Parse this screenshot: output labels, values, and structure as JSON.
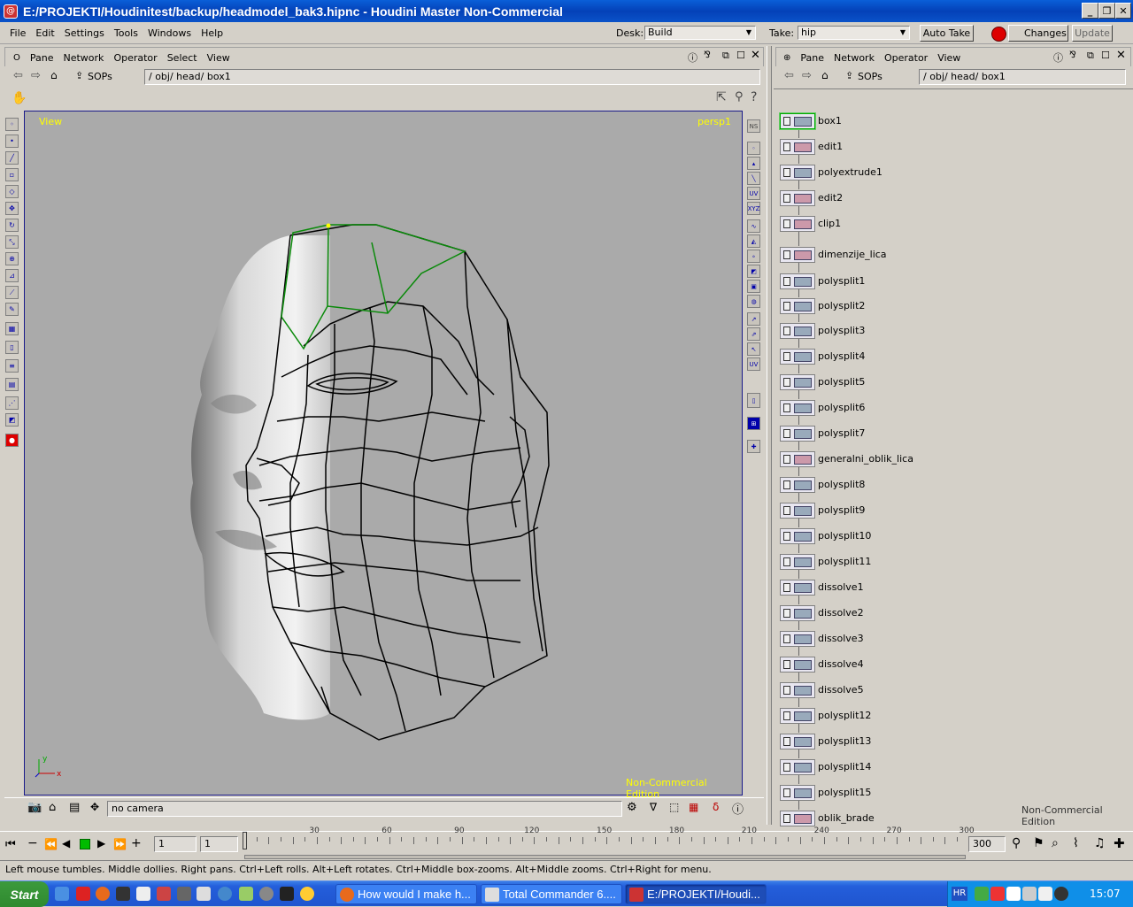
{
  "window": {
    "title": "E:/PROJEKTI/Houdinitest/backup/headmodel_bak3.hipnc - Houdini Master Non-Commercial"
  },
  "menu": [
    "File",
    "Edit",
    "Settings",
    "Tools",
    "Windows",
    "Help"
  ],
  "desk": {
    "label": "Desk:",
    "value": "Build"
  },
  "take": {
    "label": "Take:",
    "value": "hip"
  },
  "buttons": {
    "auto_take": "Auto Take",
    "changes": "Changes",
    "update": "Update"
  },
  "left_pane": {
    "menu": [
      "Pane",
      "Network",
      "Operator",
      "Select",
      "View"
    ],
    "context": "SOPs",
    "path": "/ obj/ head/ box1"
  },
  "right_pane": {
    "menu": [
      "Pane",
      "Network",
      "Operator",
      "View"
    ],
    "context": "SOPs",
    "path": "/ obj/ head/ box1"
  },
  "viewport": {
    "label_left": "View",
    "label_right": "persp1",
    "watermark": "Non-Commercial Edition",
    "camera": "no camera",
    "axis_x": "x",
    "axis_y": "y",
    "accent": "#ffff00",
    "selection_color": "#00aa00"
  },
  "nodes": [
    "box1",
    "edit1",
    "polyextrude1",
    "edit2",
    "clip1",
    "dimenzije_lica",
    "polysplit1",
    "polysplit2",
    "polysplit3",
    "polysplit4",
    "polysplit5",
    "polysplit6",
    "polysplit7",
    "generalni_oblik_lica",
    "polysplit8",
    "polysplit9",
    "polysplit10",
    "polysplit11",
    "dissolve1",
    "dissolve2",
    "dissolve3",
    "dissolve4",
    "dissolve5",
    "polysplit12",
    "polysplit13",
    "polysplit14",
    "polysplit15",
    "oblik_brade"
  ],
  "network_watermark": "Non-Commercial Edition",
  "timeline": {
    "start": "1",
    "current": "1",
    "end": "300",
    "ticks": [
      "30",
      "60",
      "90",
      "120",
      "150",
      "180",
      "210",
      "240",
      "270",
      "300"
    ]
  },
  "status_text": "Left mouse tumbles. Middle dollies. Right pans. Ctrl+Left rolls. Alt+Left rotates. Ctrl+Middle box-zooms. Alt+Middle zooms. Ctrl+Right for menu.",
  "taskbar": {
    "start": "Start",
    "tasks": [
      "How would I make h...",
      "Total Commander 6....",
      "E:/PROJEKTI/Houdi..."
    ],
    "language": "HR",
    "clock": "15:07"
  }
}
